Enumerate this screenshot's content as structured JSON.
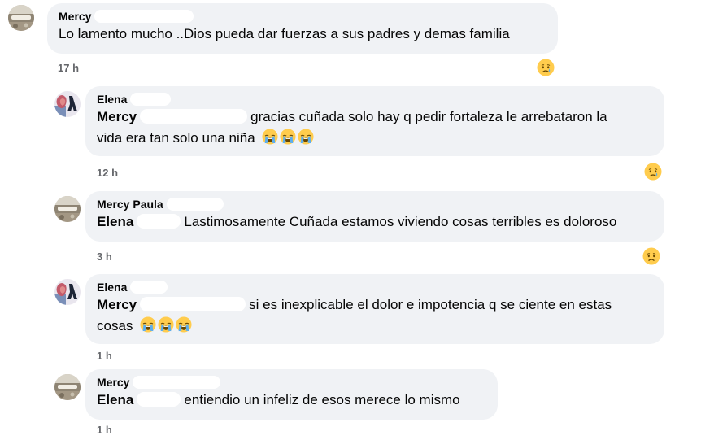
{
  "comments": [
    {
      "author": "Mercy",
      "text": "Lo lamento mucho ..Dios pueda dar fuerzas a sus padres y demas familia",
      "time": "17 h",
      "reaction": "crying-face-icon"
    },
    {
      "author": "Elena",
      "mention": "Mercy",
      "text_line1": "gracias cuñada solo hay q pedir fortaleza le arrebataron la",
      "text_line2": "vida era tan solo una niña",
      "emojis": [
        "loudly-crying-face-icon",
        "loudly-crying-face-icon",
        "loudly-crying-face-icon"
      ],
      "time": "12 h",
      "reaction": "crying-face-icon"
    },
    {
      "author": "Mercy Paula",
      "mention": "Elena",
      "text": "Lastimosamente Cuñada estamos viviendo cosas terribles es doloroso",
      "time": "3 h",
      "reaction": "crying-face-icon"
    },
    {
      "author": "Elena",
      "mention": "Mercy",
      "text_line1": "si es inexplicable el dolor e impotencia q se ciente en estas",
      "text_line2": "cosas",
      "emojis": [
        "loudly-crying-face-icon",
        "loudly-crying-face-icon",
        "loudly-crying-face-icon"
      ],
      "time": "1 h"
    },
    {
      "author": "Mercy",
      "mention": "Elena",
      "text": "entiendio un infeliz de esos merece lo mismo",
      "time": "1 h"
    }
  ],
  "colors": {
    "bubble": "#f0f2f5",
    "meta_text": "#65676b",
    "text": "#050505",
    "emoji_yellow": "#ffcc4d"
  }
}
